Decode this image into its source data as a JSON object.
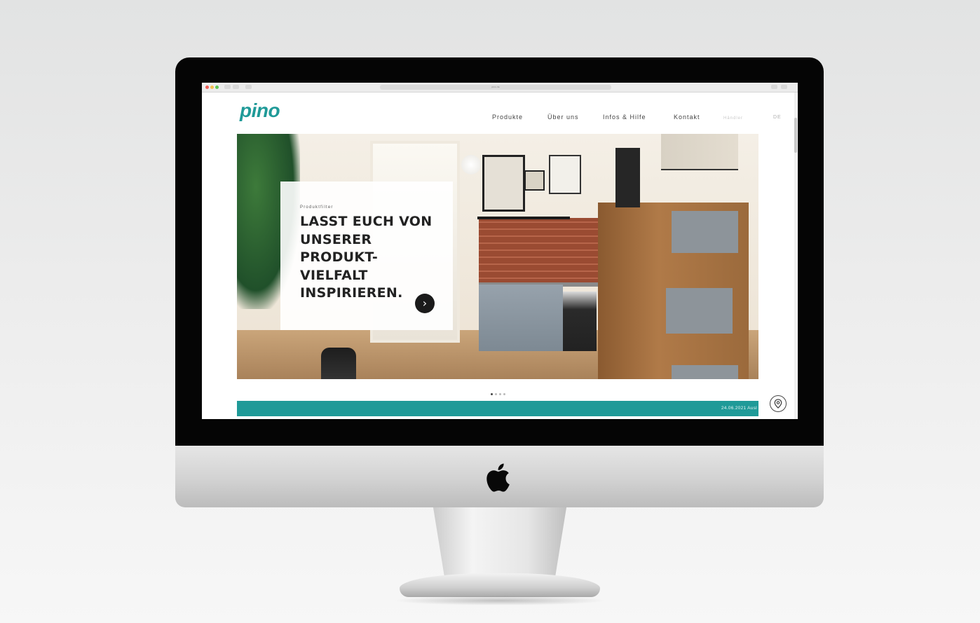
{
  "browser": {
    "url": "pino.de"
  },
  "site": {
    "logo": "pino",
    "nav": {
      "products": "Produkte",
      "about": "Über uns",
      "info": "Infos & Hilfe",
      "contact": "Kontakt",
      "dealer": "Händler",
      "lang": "DE"
    }
  },
  "hero": {
    "eyebrow": "Produktfilter",
    "headline": "LASST EUCH VON\nUNSERER\nPRODUKT-\nVIELFALT\nINSPIRIEREN.",
    "arrow": "›"
  },
  "slider": {
    "slide_count": 4,
    "active_index": 0
  },
  "ticker": {
    "text": "24.06.2021 Ausl"
  },
  "icons": [
    "apple-logo",
    "location-pin-icon",
    "chevron-right-icon"
  ],
  "colors": {
    "brand": "#1f9a98",
    "text": "#222222",
    "bezel": "#050505"
  }
}
